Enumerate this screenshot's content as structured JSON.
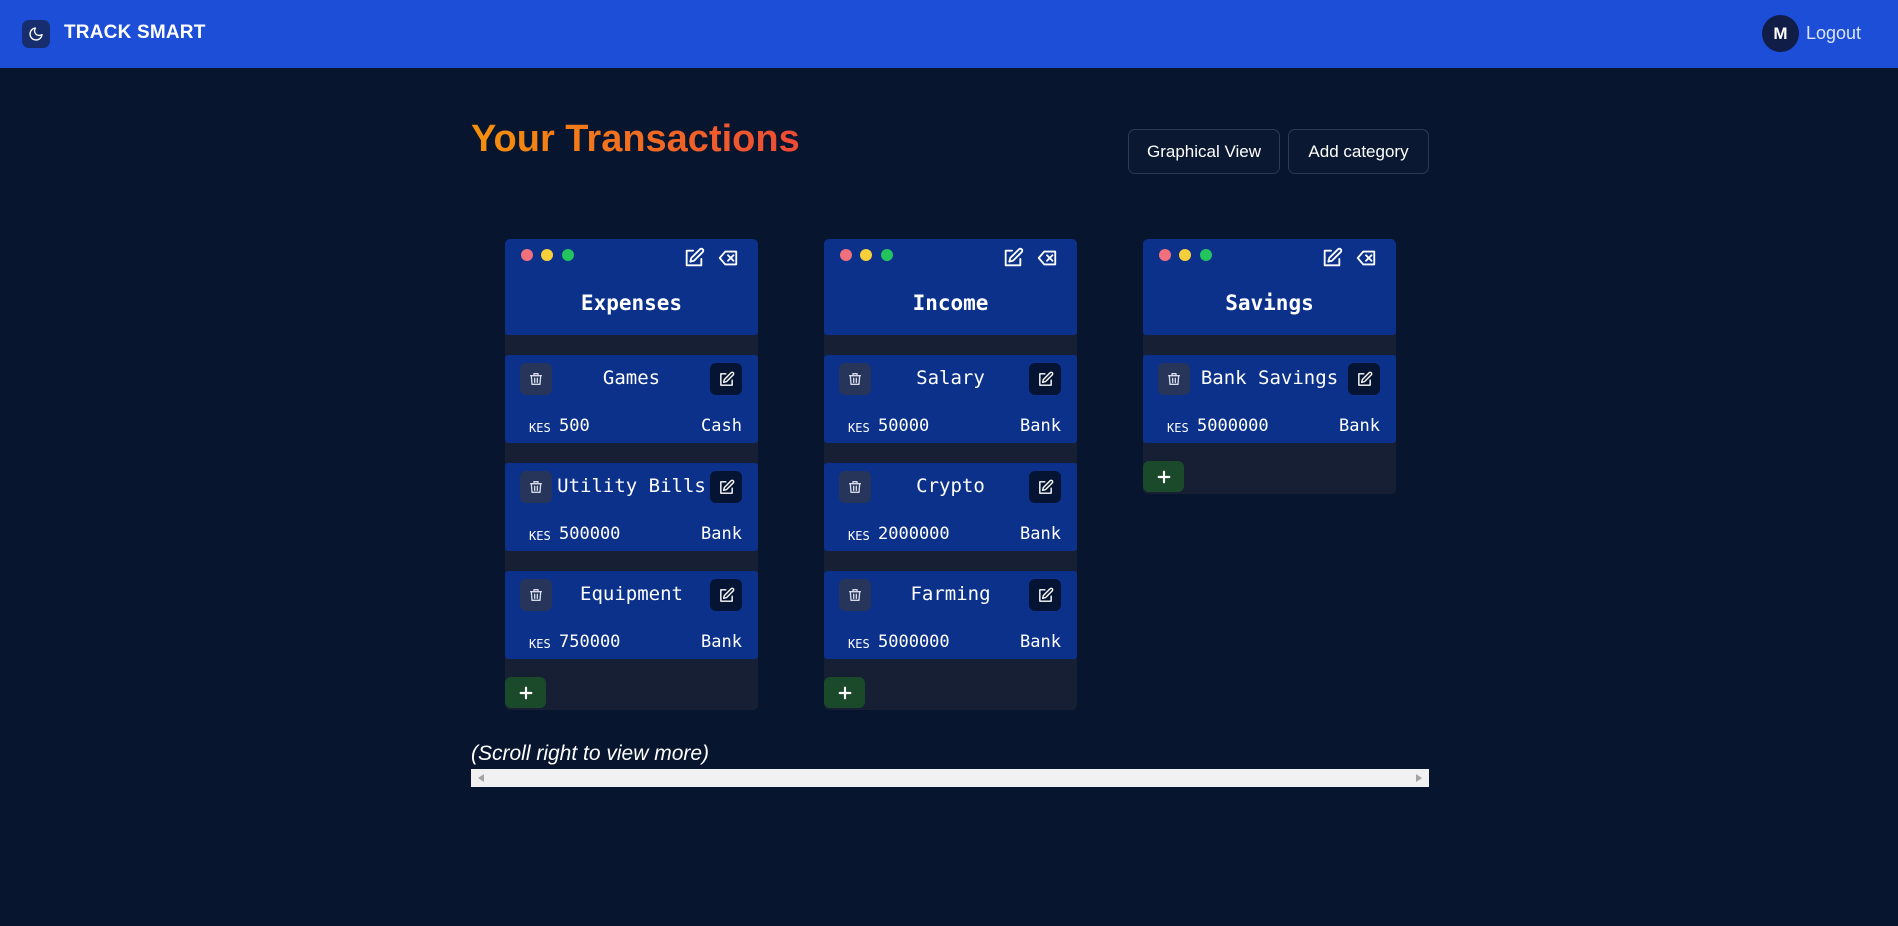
{
  "app": {
    "brand": "TRACK SMART",
    "avatar_initial": "M",
    "logout_label": "Logout"
  },
  "page": {
    "title": "Your Transactions",
    "graphical_view_label": "Graphical View",
    "add_category_label": "Add category"
  },
  "categories": [
    {
      "title": "Expenses",
      "items": [
        {
          "name": "Games",
          "currency": "KES",
          "amount": "500",
          "source": "Cash"
        },
        {
          "name": "Utility Bills",
          "currency": "KES",
          "amount": "500000",
          "source": "Bank"
        },
        {
          "name": "Equipment",
          "currency": "KES",
          "amount": "750000",
          "source": "Bank"
        }
      ]
    },
    {
      "title": "Income",
      "items": [
        {
          "name": "Salary",
          "currency": "KES",
          "amount": "50000",
          "source": "Bank"
        },
        {
          "name": "Crypto",
          "currency": "KES",
          "amount": "2000000",
          "source": "Bank"
        },
        {
          "name": "Farming",
          "currency": "KES",
          "amount": "5000000",
          "source": "Bank"
        }
      ]
    },
    {
      "title": "Savings",
      "items": [
        {
          "name": "Bank Savings",
          "currency": "KES",
          "amount": "5000000",
          "source": "Bank"
        }
      ]
    }
  ],
  "scroll_hint": "(Scroll right to view more)",
  "colors": {
    "navbar": "#1d4ed8",
    "background": "#07152f",
    "card": "#0b318a",
    "add_button": "#1a4a2a",
    "title_gradient_start": "#f5900b",
    "title_gradient_end": "#ee4a36"
  }
}
